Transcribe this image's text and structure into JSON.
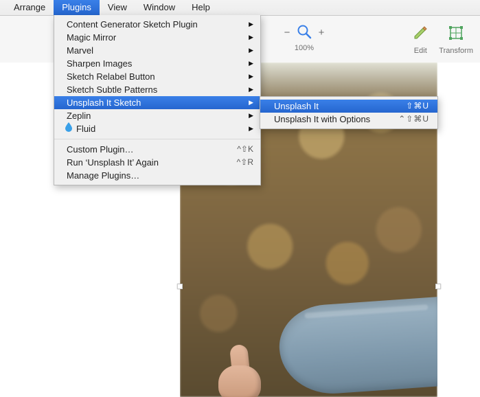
{
  "menubar": {
    "items": [
      "Arrange",
      "Plugins",
      "View",
      "Window",
      "Help"
    ],
    "active_index": 1
  },
  "toolbar": {
    "zoom": {
      "minus": "−",
      "plus": "+",
      "label": "100%"
    },
    "tools": [
      {
        "name": "edit-tool",
        "label": "Edit"
      },
      {
        "name": "transform-tool",
        "label": "Transform"
      }
    ]
  },
  "plugins_menu": {
    "items": [
      {
        "label": "Content Generator Sketch Plugin",
        "submenu": true
      },
      {
        "label": "Magic Mirror",
        "submenu": true
      },
      {
        "label": "Marvel",
        "submenu": true
      },
      {
        "label": "Sharpen Images",
        "submenu": true
      },
      {
        "label": "Sketch Relabel Button",
        "submenu": true
      },
      {
        "label": "Sketch Subtle Patterns",
        "submenu": true
      },
      {
        "label": "Unsplash It Sketch",
        "submenu": true,
        "selected": true
      },
      {
        "label": "Zeplin",
        "submenu": true
      },
      {
        "label": "Fluid",
        "submenu": true,
        "icon": "droplet-icon"
      }
    ],
    "footer": [
      {
        "label": "Custom Plugin…",
        "shortcut": "^⇧K"
      },
      {
        "label": "Run ‘Unsplash It’ Again",
        "shortcut": "^⇧R"
      },
      {
        "label": "Manage Plugins…",
        "shortcut": ""
      }
    ]
  },
  "unsplash_submenu": {
    "items": [
      {
        "label": "Unsplash It",
        "shortcut": "⇧⌘U",
        "selected": true
      },
      {
        "label": "Unsplash It with Options",
        "shortcut": "⌃⇧⌘U"
      }
    ]
  }
}
